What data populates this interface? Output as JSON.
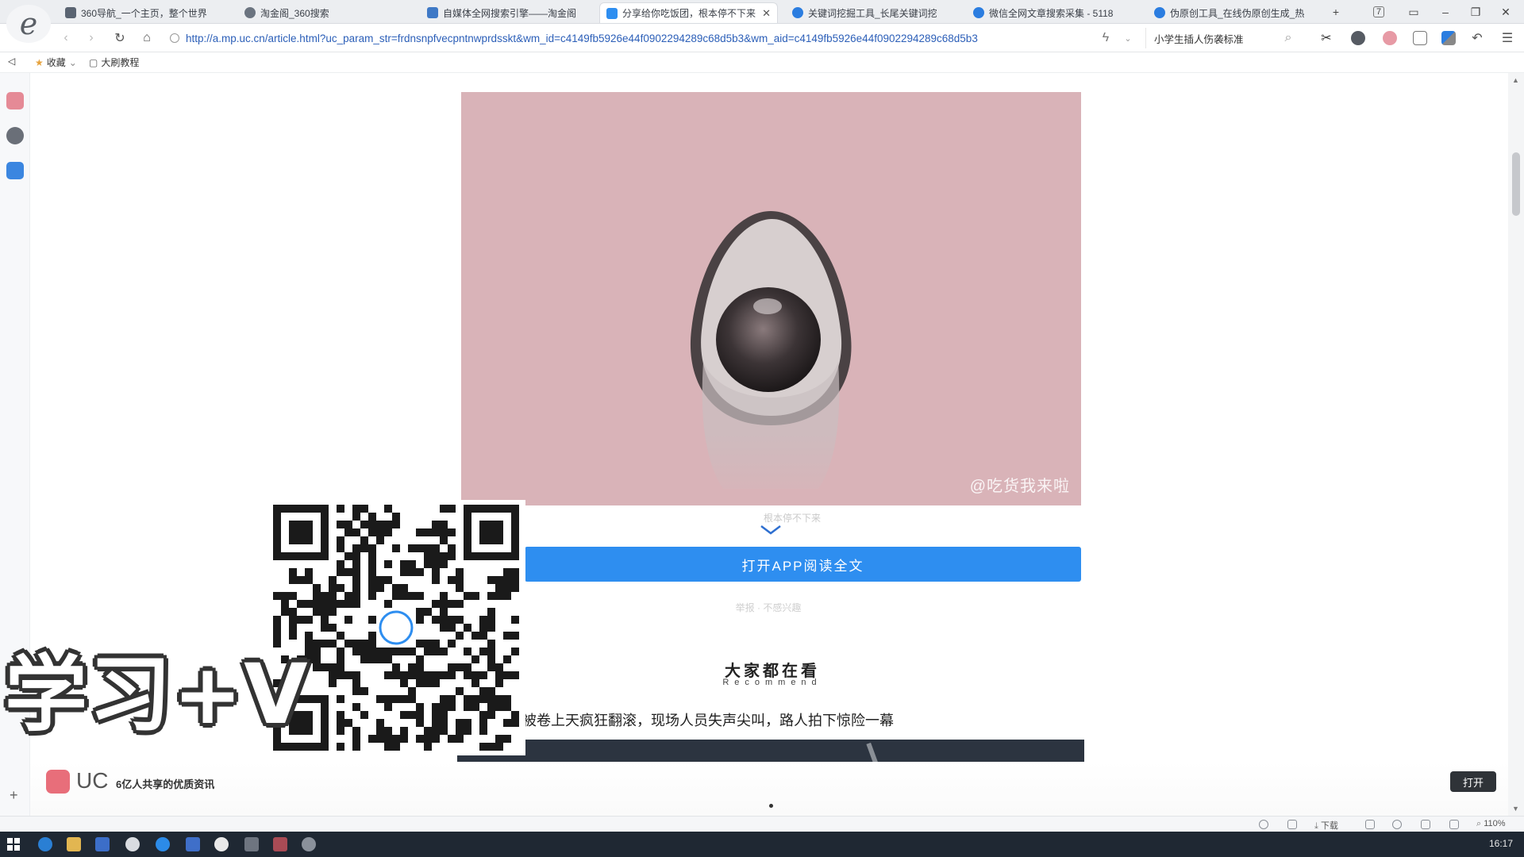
{
  "browser": {
    "tabs": [
      {
        "label": "360导航_一个主页，整个世界",
        "color": "#5a6472"
      },
      {
        "label": "淘金阁_360搜索",
        "color": "#6b7480"
      },
      {
        "label": "自媒体全网搜索引擎——淘金阁",
        "color": "#3f79c6"
      },
      {
        "label": "分享给你吃饭团，根本停不下来",
        "color": "#2e8ef0",
        "active": true
      },
      {
        "label": "关键词挖掘工具_长尾关键词挖",
        "color": "#2b7de0"
      },
      {
        "label": "微信全网文章搜索采集 - 5118",
        "color": "#2b7de0"
      },
      {
        "label": "伪原创工具_在线伪原创生成_热",
        "color": "#2b7de0"
      }
    ],
    "tab_count": "7",
    "url": "http://a.mp.uc.cn/article.html?uc_param_str=frdnsnpfvecpntnwprdsskt&wm_id=c4149fb5926e44f0902294289c68d5b3&wm_aid=c4149fb5926e44f0902294289c68d5b3",
    "search_placeholder": "小学生插人伤袭标准",
    "favorites": [
      {
        "label": "收藏"
      },
      {
        "label": "大刷教程"
      }
    ]
  },
  "article": {
    "image_watermark": "@吃货我来啦",
    "caption": "根本停不下来",
    "open_app_label": "打开APP阅读全文",
    "feedback": "举报 · 不感兴趣"
  },
  "recommend": {
    "title": "大家都在看",
    "subtitle": "Recommend",
    "news_title": "被卷上天疯狂翻滚，现场人员失声尖叫，路人拍下惊险一幕"
  },
  "footer": {
    "logo": "UC",
    "slogan": "6亿人共享的优质资讯",
    "open_label": "打开"
  },
  "overlay": {
    "promo_text": "学习+V"
  },
  "statusbar": {
    "download": "下载",
    "zoom": "110%"
  },
  "taskbar": {
    "clock": "16:17"
  },
  "colors": {
    "accent": "#2e8ef0",
    "image_bg": "#d9b3b8"
  }
}
